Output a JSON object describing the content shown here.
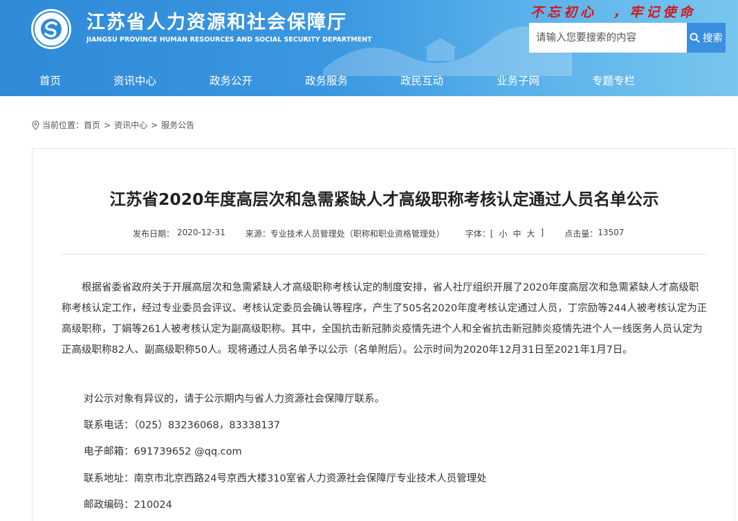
{
  "header": {
    "site_title_cn": "江苏省人力资源和社会保障厅",
    "site_title_en": "JIANGSU PROVINCE HUMAN RESOURCES AND SOCIAL SECURITY DEPARTMENT",
    "slogan": "不忘初心  ，牢记使命",
    "colors": {
      "banner": "#3a97e0",
      "slogan": "#d8141a",
      "search_button": "#3a8fe0"
    }
  },
  "search": {
    "placeholder": "请输入您要搜索的内容",
    "button_label": "搜索"
  },
  "nav": {
    "items": [
      "首页",
      "资讯中心",
      "政务公开",
      "政务服务",
      "政民互动",
      "业务子网",
      "专题专栏"
    ]
  },
  "breadcrumb": {
    "prefix": "当前位置：",
    "items": [
      "首页",
      "资讯中心",
      "服务公告"
    ],
    "separator": ">"
  },
  "article": {
    "title": "江苏省2020年度高层次和急需紧缺人才高级职称考核认定通过人员名单公示",
    "meta": {
      "date_label": "发布日期：",
      "date": "2020-12-31",
      "source_label": "来源：",
      "source": "专业技术人员管理处（职称和职业资格管理处）",
      "font_label": "字体：[",
      "font_small": "小",
      "font_medium": "中",
      "font_large": "大",
      "font_close": "]",
      "views_label": "点击量：",
      "views": "13507"
    },
    "paragraph_1": "根据省委省政府关于开展高层次和急需紧缺人才高级职称考核认定的制度安排，省人社厅组织开展了2020年度高层次和急需紧缺人才高级职称考核认定工作，经过专业委员会评议、考核认定委员会确认等程序，产生了505名2020年度考核认定通过人员，丁宗励等244人被考核认定为正高级职称，丁娟等261人被考核认定为副高级职称。其中，全国抗击新冠肺炎疫情先进个人和全省抗击新冠肺炎疫情先进个人一线医务人员认定为正高级职称82人、副高级职称50人。现将通过人员名单予以公示（名单附后）。公示时间为2020年12月31日至2021年1月7日。",
    "paragraph_2": "对公示对象有异议的，请于公示期内与省人力资源社会保障厅联系。",
    "phone": "联系电话：（025）83236068，83338137",
    "email": "电子邮箱：691739652 @qq.com",
    "address": "联系地址：南京市北京西路24号京西大楼310室省人力资源社会保障厅专业技术人员管理处",
    "postcode": "邮政编码：210024"
  }
}
